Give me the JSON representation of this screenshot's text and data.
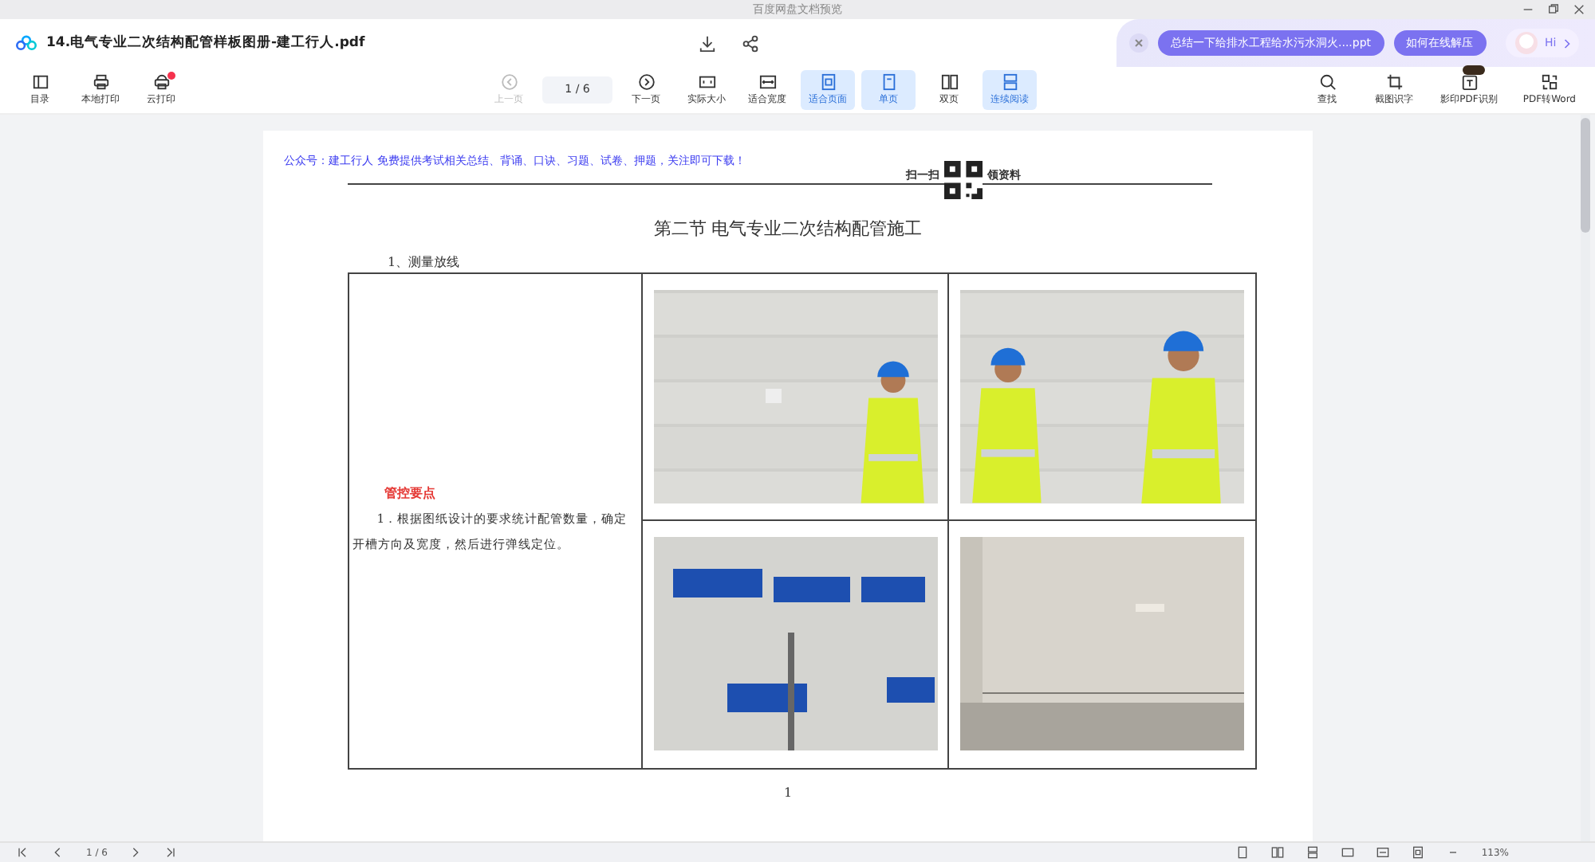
{
  "window": {
    "title": "百度网盘文档预览"
  },
  "header": {
    "file_name": "14.电气专业二次结构配管样板图册-建工行人.pdf",
    "suggestions": [
      "总结一下给排水工程给水污水洞火....ppt",
      "如何在线解压"
    ],
    "assistant_greeting": "Hi"
  },
  "toolbar": {
    "left": [
      {
        "label": "目录",
        "dot": false
      },
      {
        "label": "本地打印",
        "dot": false
      },
      {
        "label": "云打印",
        "dot": true
      }
    ],
    "page_field": "1 / 6",
    "center": [
      {
        "label": "上一页",
        "selected": false,
        "disabled": true
      },
      {
        "label": "下一页",
        "selected": false,
        "disabled": false
      },
      {
        "label": "实际大小",
        "selected": false,
        "disabled": false
      },
      {
        "label": "适合宽度",
        "selected": false,
        "disabled": false
      },
      {
        "label": "适合页面",
        "selected": true,
        "disabled": false
      },
      {
        "label": "单页",
        "selected": true,
        "disabled": false
      },
      {
        "label": "双页",
        "selected": false,
        "disabled": false
      },
      {
        "label": "连续阅读",
        "selected": true,
        "disabled": false
      }
    ],
    "right": [
      {
        "label": "查找",
        "badge": false
      },
      {
        "label": "截图识字",
        "badge": false
      },
      {
        "label": "影印PDF识别",
        "badge": true
      },
      {
        "label": "PDF转Word",
        "badge": false
      }
    ]
  },
  "document": {
    "notice": "公众号：建工行人 免费提供考试相关总结、背诵、口诀、习题、试卷、押题，关注即可下载！",
    "scan_left": "扫一扫",
    "scan_right": "领资料",
    "title": "第二节  电气专业二次结构配管施工",
    "step": "1、测量放线",
    "key_heading": "管控要点",
    "key_text": "1．根据图纸设计的要求统计配管数量，确定开槽方向及宽度，然后进行弹线定位。",
    "page_number": "1"
  },
  "status_bar": {
    "page": "1 / 6",
    "zoom": "113%"
  }
}
